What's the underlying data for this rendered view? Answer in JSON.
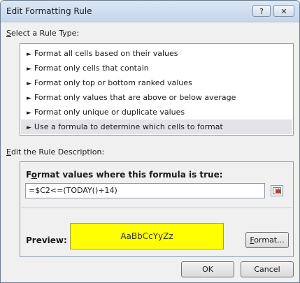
{
  "window": {
    "title": "Edit Formatting Rule",
    "help_glyph": "?",
    "close_glyph": "✕"
  },
  "rule_type": {
    "label_prefix": "S",
    "label_rest": "elect a Rule Type:",
    "arrow_glyph": "►",
    "items": [
      {
        "label": "Format all cells based on their values",
        "selected": false
      },
      {
        "label": "Format only cells that contain",
        "selected": false
      },
      {
        "label": "Format only top or bottom ranked values",
        "selected": false
      },
      {
        "label": "Format only values that are above or below average",
        "selected": false
      },
      {
        "label": "Format only unique or duplicate values",
        "selected": false
      },
      {
        "label": "Use a formula to determine which cells to format",
        "selected": true
      }
    ]
  },
  "rule_description": {
    "label_prefix": "E",
    "label_rest": "dit the Rule Description:",
    "formula_heading_pre": "F",
    "formula_heading_u": "o",
    "formula_heading_post": "rmat values where this formula is true:",
    "formula_value": "=$C2<=(TODAY()+14)",
    "preview_label": "Preview:",
    "preview_text": "AaBbCcYyZz",
    "preview_color": "#ffff00",
    "format_button_prefix": "F",
    "format_button_rest": "ormat..."
  },
  "buttons": {
    "ok": "OK",
    "cancel": "Cancel"
  }
}
